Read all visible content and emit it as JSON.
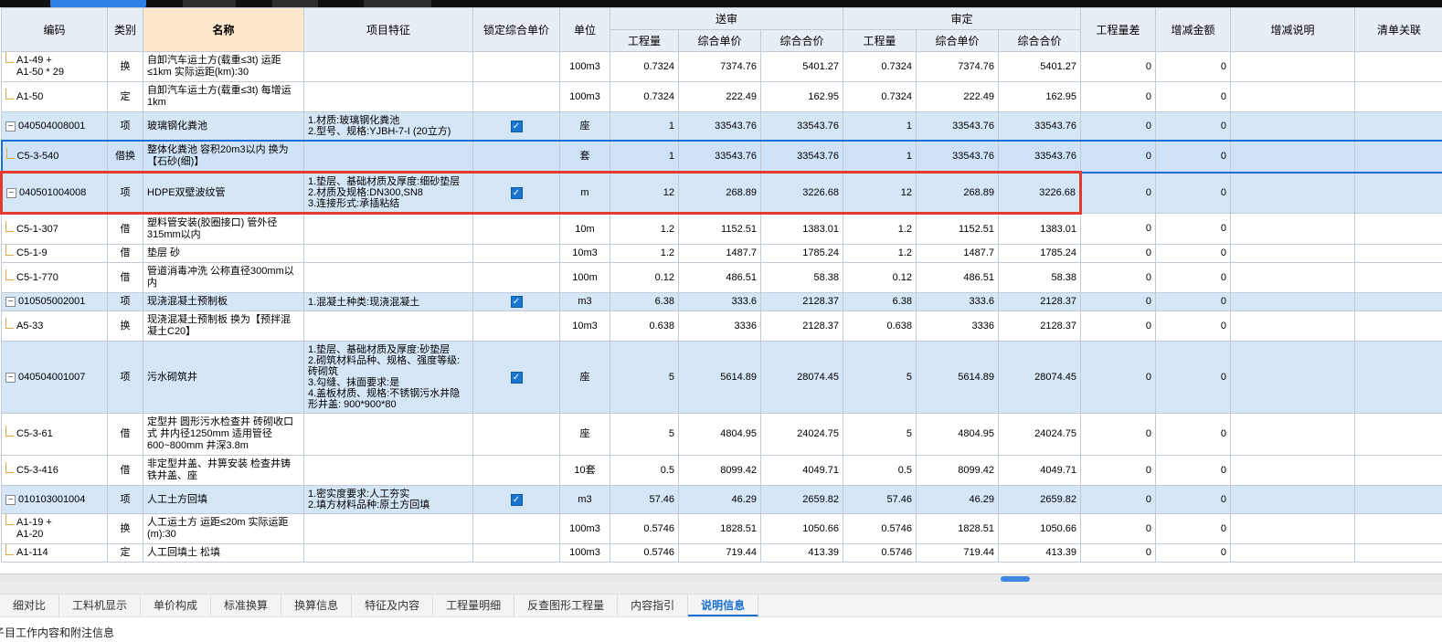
{
  "colors": {
    "accent_blue": "#1a6fd4",
    "item_row_bg": "#d5e6f7",
    "selected_border": "#1a6fd4",
    "red_annotation": "#e23a2e",
    "header_bg": "#e7eef6",
    "name_header_bg": "#fde8cd",
    "tree_line": "#e0a44a",
    "checkbox_blue": "#1976d2"
  },
  "grid": {
    "columns": {
      "code": "编码",
      "category": "类别",
      "name": "名称",
      "features": "项目特征",
      "lock": "锁定综合单价",
      "unit": "单位",
      "submit_group": "送审",
      "approve_group": "审定",
      "qty": "工程量",
      "unit_price": "综合单价",
      "total_price": "综合合价",
      "qty_diff": "工程量差",
      "amount_diff": "增减金额",
      "diff_note": "增减说明",
      "list_link": "清单关联"
    },
    "rows": [
      {
        "type": "sub",
        "code": "A1-49 +\nA1-50 * 29",
        "cat": "换",
        "name": "自卸汽车运土方(载重≤3t) 运距≤1km 实际运距(km):30",
        "features": "",
        "locked": false,
        "unit": "100m3",
        "s_qty": "0.7324",
        "s_price": "7374.76",
        "s_total": "5401.27",
        "a_qty": "0.7324",
        "a_price": "7374.76",
        "a_total": "5401.27",
        "qty_diff": "0",
        "amount": "0",
        "note": "",
        "link": ""
      },
      {
        "type": "sub",
        "code": "A1-50",
        "cat": "定",
        "name": "自卸汽车运土方(载重≤3t) 每增运1km",
        "features": "",
        "locked": false,
        "unit": "100m3",
        "s_qty": "0.7324",
        "s_price": "222.49",
        "s_total": "162.95",
        "a_qty": "0.7324",
        "a_price": "222.49",
        "a_total": "162.95",
        "qty_diff": "0",
        "amount": "0",
        "note": "",
        "link": ""
      },
      {
        "type": "item",
        "code": "040504008001",
        "cat": "项",
        "name": "玻璃钢化粪池",
        "features": "1.材质:玻璃钢化粪池\n2.型号、规格:YJBH-7-I (20立方)",
        "locked": true,
        "unit": "座",
        "s_qty": "1",
        "s_price": "33543.76",
        "s_total": "33543.76",
        "a_qty": "1",
        "a_price": "33543.76",
        "a_total": "33543.76",
        "qty_diff": "0",
        "amount": "0",
        "note": "",
        "link": ""
      },
      {
        "type": "sub",
        "selected": true,
        "code": "C5-3-540",
        "cat": "借换",
        "name": "整体化粪池 容积20m3以内 换为【石砂(细)】",
        "features": "",
        "locked": false,
        "unit": "套",
        "s_qty": "1",
        "s_price": "33543.76",
        "s_total": "33543.76",
        "a_qty": "1",
        "a_price": "33543.76",
        "a_total": "33543.76",
        "qty_diff": "0",
        "amount": "0",
        "note": "",
        "link": ""
      },
      {
        "type": "item",
        "red": true,
        "code": "040501004008",
        "cat": "项",
        "name": "HDPE双壁波纹管",
        "features": "1.垫层、基础材质及厚度:细砂垫层\n2.材质及规格:DN300,SN8\n3.连接形式:承插粘结",
        "locked": true,
        "unit": "m",
        "s_qty": "12",
        "s_price": "268.89",
        "s_total": "3226.68",
        "a_qty": "12",
        "a_price": "268.89",
        "a_total": "3226.68",
        "qty_diff": "0",
        "amount": "0",
        "note": "",
        "link": ""
      },
      {
        "type": "sub",
        "code": "C5-1-307",
        "cat": "借",
        "name": "塑料管安装(胶圈接口) 管外径315mm以内",
        "features": "",
        "locked": false,
        "unit": "10m",
        "s_qty": "1.2",
        "s_price": "1152.51",
        "s_total": "1383.01",
        "a_qty": "1.2",
        "a_price": "1152.51",
        "a_total": "1383.01",
        "qty_diff": "0",
        "amount": "0",
        "note": "",
        "link": ""
      },
      {
        "type": "sub",
        "code": "C5-1-9",
        "cat": "借",
        "name": "垫层 砂",
        "features": "",
        "locked": false,
        "unit": "10m3",
        "s_qty": "1.2",
        "s_price": "1487.7",
        "s_total": "1785.24",
        "a_qty": "1.2",
        "a_price": "1487.7",
        "a_total": "1785.24",
        "qty_diff": "0",
        "amount": "0",
        "note": "",
        "link": ""
      },
      {
        "type": "sub",
        "code": "C5-1-770",
        "cat": "借",
        "name": "管道消毒冲洗 公称直径300mm以内",
        "features": "",
        "locked": false,
        "unit": "100m",
        "s_qty": "0.12",
        "s_price": "486.51",
        "s_total": "58.38",
        "a_qty": "0.12",
        "a_price": "486.51",
        "a_total": "58.38",
        "qty_diff": "0",
        "amount": "0",
        "note": "",
        "link": ""
      },
      {
        "type": "item",
        "code": "010505002001",
        "cat": "项",
        "name": "现浇混凝土预制板",
        "features": "1.混凝土种类:现浇混凝土",
        "locked": true,
        "unit": "m3",
        "s_qty": "6.38",
        "s_price": "333.6",
        "s_total": "2128.37",
        "a_qty": "6.38",
        "a_price": "333.6",
        "a_total": "2128.37",
        "qty_diff": "0",
        "amount": "0",
        "note": "",
        "link": ""
      },
      {
        "type": "sub",
        "code": "A5-33",
        "cat": "换",
        "name": "现浇混凝土预制板 换为【预拌混凝土C20】",
        "features": "",
        "locked": false,
        "unit": "10m3",
        "s_qty": "0.638",
        "s_price": "3336",
        "s_total": "2128.37",
        "a_qty": "0.638",
        "a_price": "3336",
        "a_total": "2128.37",
        "qty_diff": "0",
        "amount": "0",
        "note": "",
        "link": ""
      },
      {
        "type": "item",
        "code": "040504001007",
        "cat": "项",
        "name": "污水砌筑井",
        "features": "1.垫层、基础材质及厚度:砂垫层\n2.砌筑材料品种、规格、强度等级:砖砌筑\n3.勾缝、抹面要求:是\n4.盖板材质、规格:不锈钢污水井隐形井盖: 900*900*80",
        "locked": true,
        "unit": "座",
        "s_qty": "5",
        "s_price": "5614.89",
        "s_total": "28074.45",
        "a_qty": "5",
        "a_price": "5614.89",
        "a_total": "28074.45",
        "qty_diff": "0",
        "amount": "0",
        "note": "",
        "link": ""
      },
      {
        "type": "sub",
        "code": "C5-3-61",
        "cat": "借",
        "name": "定型井 圆形污水检查井 砖砌收口式 井内径1250mm 适用管径600~800mm 井深3.8m",
        "features": "",
        "locked": false,
        "unit": "座",
        "s_qty": "5",
        "s_price": "4804.95",
        "s_total": "24024.75",
        "a_qty": "5",
        "a_price": "4804.95",
        "a_total": "24024.75",
        "qty_diff": "0",
        "amount": "0",
        "note": "",
        "link": ""
      },
      {
        "type": "sub",
        "code": "C5-3-416",
        "cat": "借",
        "name": "非定型井盖、井箅安装 检查井铸铁井盖、座",
        "features": "",
        "locked": false,
        "unit": "10套",
        "s_qty": "0.5",
        "s_price": "8099.42",
        "s_total": "4049.71",
        "a_qty": "0.5",
        "a_price": "8099.42",
        "a_total": "4049.71",
        "qty_diff": "0",
        "amount": "0",
        "note": "",
        "link": ""
      },
      {
        "type": "item",
        "code": "010103001004",
        "cat": "项",
        "name": "人工土方回填",
        "features": "1.密实度要求:人工夯实\n2.填方材料品种:原土方回填",
        "locked": true,
        "unit": "m3",
        "s_qty": "57.46",
        "s_price": "46.29",
        "s_total": "2659.82",
        "a_qty": "57.46",
        "a_price": "46.29",
        "a_total": "2659.82",
        "qty_diff": "0",
        "amount": "0",
        "note": "",
        "link": ""
      },
      {
        "type": "sub",
        "code": "A1-19 +\nA1-20",
        "cat": "换",
        "name": "人工运土方 运距≤20m 实际运距(m):30",
        "features": "",
        "locked": false,
        "unit": "100m3",
        "s_qty": "0.5746",
        "s_price": "1828.51",
        "s_total": "1050.66",
        "a_qty": "0.5746",
        "a_price": "1828.51",
        "a_total": "1050.66",
        "qty_diff": "0",
        "amount": "0",
        "note": "",
        "link": ""
      },
      {
        "type": "sub",
        "code": "A1-114",
        "cat": "定",
        "name": "人工回填土 松填",
        "features": "",
        "locked": false,
        "unit": "100m3",
        "s_qty": "0.5746",
        "s_price": "719.44",
        "s_total": "413.39",
        "a_qty": "0.5746",
        "a_price": "719.44",
        "a_total": "413.39",
        "qty_diff": "0",
        "amount": "0",
        "note": "",
        "link": ""
      }
    ]
  },
  "tabs": {
    "items": [
      "细对比",
      "工料机显示",
      "单价构成",
      "标准换算",
      "换算信息",
      "特征及内容",
      "工程量明细",
      "反查图形工程量",
      "内容指引",
      "说明信息"
    ],
    "active": "说明信息"
  },
  "footer": {
    "note": "子目工作内容和附注信息"
  }
}
